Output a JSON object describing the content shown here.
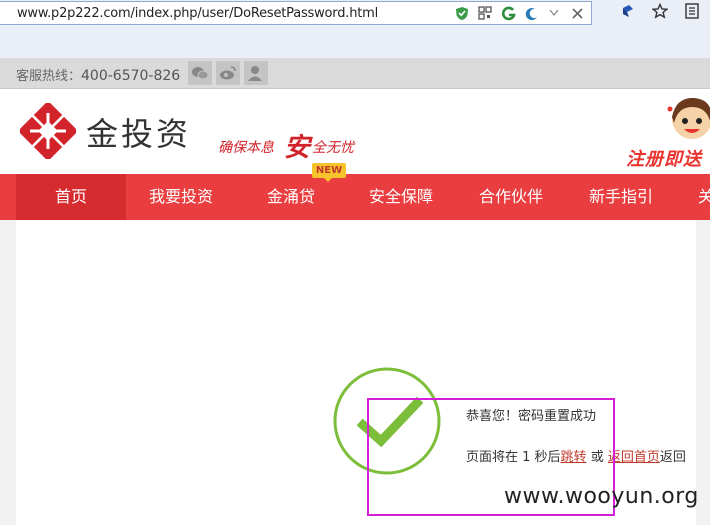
{
  "browser": {
    "url": "www.p2p222.com/index.php/user/DoResetPassword.html"
  },
  "topbar": {
    "hotline_label": "客服热线：",
    "hotline_number": "400-6570-826"
  },
  "header": {
    "logo_text": "金投资",
    "slogan_part1": "确保本息",
    "slogan_big": "安",
    "slogan_part2": "全无忧",
    "promo_text": "注册即送"
  },
  "nav": {
    "items": [
      {
        "label": "首页"
      },
      {
        "label": "我要投资"
      },
      {
        "label": "金涌贷"
      },
      {
        "label": "安全保障"
      },
      {
        "label": "合作伙伴"
      },
      {
        "label": "新手指引"
      },
      {
        "label": "关"
      }
    ],
    "badge": "NEW"
  },
  "message": {
    "title": "恭喜您！密码重置成功",
    "line_prefix": "页面将在 1 秒后",
    "jump_link": "跳转",
    "or_text": " 或",
    "home_link": "返回首页",
    "suffix": "返回"
  },
  "watermark": "www.wooyun.org",
  "colors": {
    "nav_bg": "#ea3d3f",
    "brand_red": "#d2232a",
    "check_green": "#7cbd3a",
    "highlight": "#d51ed9"
  }
}
